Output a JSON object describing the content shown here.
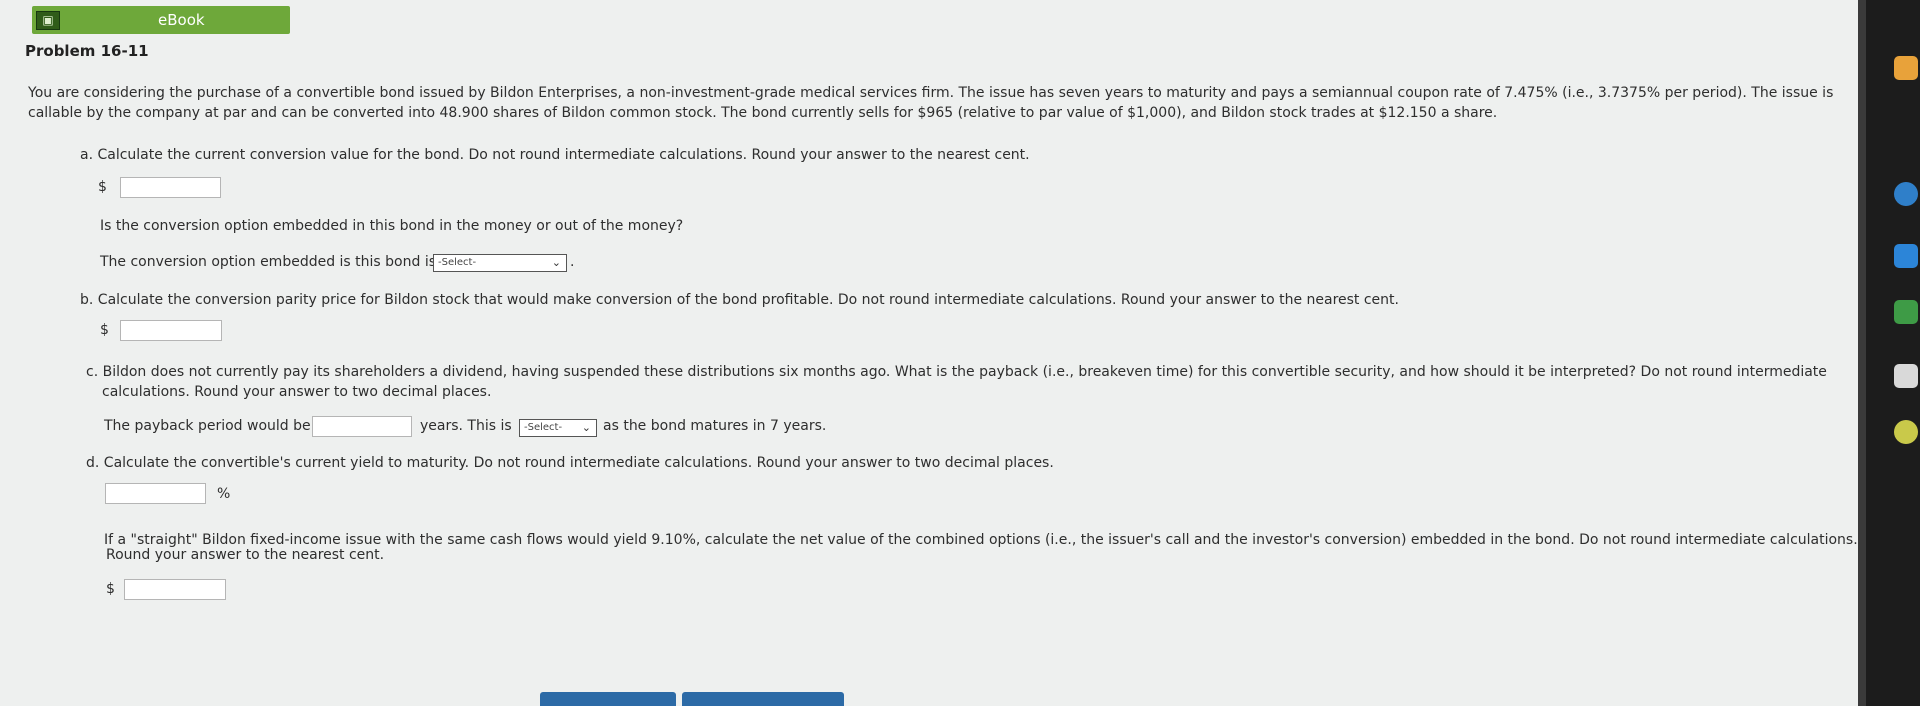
{
  "header": {
    "ebook_label": "eBook"
  },
  "problem": {
    "title": "Problem 16-11",
    "intro_line1": "You are considering the purchase of a convertible bond issued by Bildon Enterprises, a non-investment-grade medical services firm. The issue has seven years to maturity and pays a semiannual coupon rate of 7.475% (i.e., 3.7375% per period). The issue is",
    "intro_line2": "callable by the company at par and can be converted into 48.900 shares of Bildon common stock. The bond currently sells for $965 (relative to par value of $1,000), and Bildon stock trades at $12.150 a share."
  },
  "part_a": {
    "question": "a. Calculate the current conversion value for the bond. Do not round intermediate calculations. Round your answer to the nearest cent.",
    "currency": "$",
    "answer": "",
    "followup": "Is the conversion option embedded in this bond in the money or out of the money?",
    "statement": "The conversion option embedded is this bond is",
    "select_value": "-Select-",
    "period": "."
  },
  "part_b": {
    "question": "b. Calculate the conversion parity price for Bildon stock that would make conversion of the bond profitable. Do not round intermediate calculations. Round your answer to the nearest cent.",
    "currency": "$",
    "answer": ""
  },
  "part_c": {
    "question_line1": "c. Bildon does not currently pay its shareholders a dividend, having suspended these distributions six months ago. What is the payback (i.e., breakeven time) for this convertible security, and how should it be interpreted? Do not round intermediate",
    "question_line2": "calculations. Round your answer to two decimal places.",
    "stmt_before": "The payback period would be",
    "stmt_mid": "years. This is",
    "select_value": "-Select-",
    "stmt_after": "as the bond matures in 7 years.",
    "answer": ""
  },
  "part_d": {
    "question": "d. Calculate the convertible's current yield to maturity. Do not round intermediate calculations. Round your answer to two decimal places.",
    "unit": "%",
    "answer": "",
    "followup_line1": "If a \"straight\" Bildon fixed-income issue with the same cash flows would yield 9.10%, calculate the net value of the combined options (i.e., the issuer's call and the investor's conversion) embedded in the bond. Do not round intermediate calculations.",
    "followup_line2": "Round your answer to the nearest cent.",
    "currency": "$",
    "answer2": ""
  },
  "colors": {
    "ebook_green": "#6ea83a",
    "button_blue": "#2c6aa6",
    "background": "#eef0ef"
  }
}
